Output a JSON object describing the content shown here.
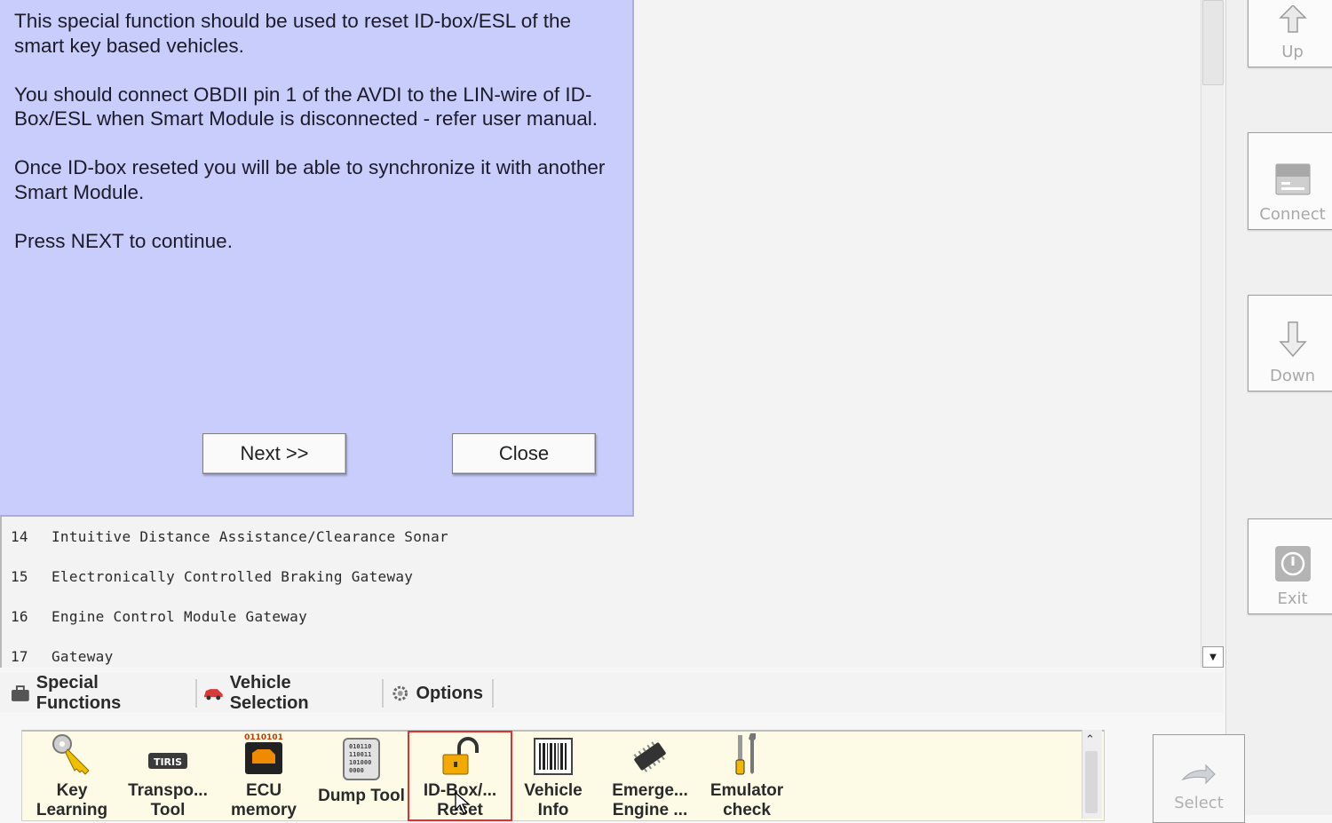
{
  "dialog": {
    "paragraphs": [
      "This special function should be used to reset ID-box/ESL of the smart key based vehicles.",
      "You should connect OBDII pin 1 of the AVDI to the LIN-wire of ID-Box/ESL when Smart Module is disconnected - refer user manual.",
      "Once ID-box reseted you will be able to synchronize it with another Smart Module.",
      "Press NEXT to continue."
    ],
    "next_label": "Next >>",
    "close_label": "Close"
  },
  "list": {
    "rows": [
      {
        "num": "14",
        "label": "Intuitive Distance Assistance/Clearance Sonar"
      },
      {
        "num": "15",
        "label": "Electronically Controlled Braking Gateway"
      },
      {
        "num": "16",
        "label": "Engine Control Module Gateway"
      },
      {
        "num": "17",
        "label": "Gateway"
      }
    ]
  },
  "side": {
    "up_label": "Up",
    "connect_label": "Connect",
    "down_label": "Down",
    "exit_label": "Exit",
    "select_label": "Select"
  },
  "tabs": {
    "special_functions": "Special Functions",
    "vehicle_selection": "Vehicle Selection",
    "options": "Options"
  },
  "tools": [
    {
      "line1": "Key",
      "line2": "Learning"
    },
    {
      "line1": "Transpo...",
      "line2": "Tool"
    },
    {
      "line1": "ECU",
      "line2": "memory"
    },
    {
      "line1": "Dump Tool",
      "line2": ""
    },
    {
      "line1": "ID-Box/...",
      "line2": "Reset"
    },
    {
      "line1": "Vehicle",
      "line2": "Info"
    },
    {
      "line1": "Emerge...",
      "line2": "Engine ..."
    },
    {
      "line1": "Emulator",
      "line2": "check"
    }
  ],
  "icons": {
    "ecu_digits": "0110101",
    "transponder_text": "TIRIS",
    "dump_bits": [
      "010110",
      "110011",
      "101000",
      "0000"
    ]
  },
  "colors": {
    "dialog_bg": "#c9cdfb",
    "tool_panel_bg": "#fdfbe6",
    "highlight": "#e03030"
  }
}
